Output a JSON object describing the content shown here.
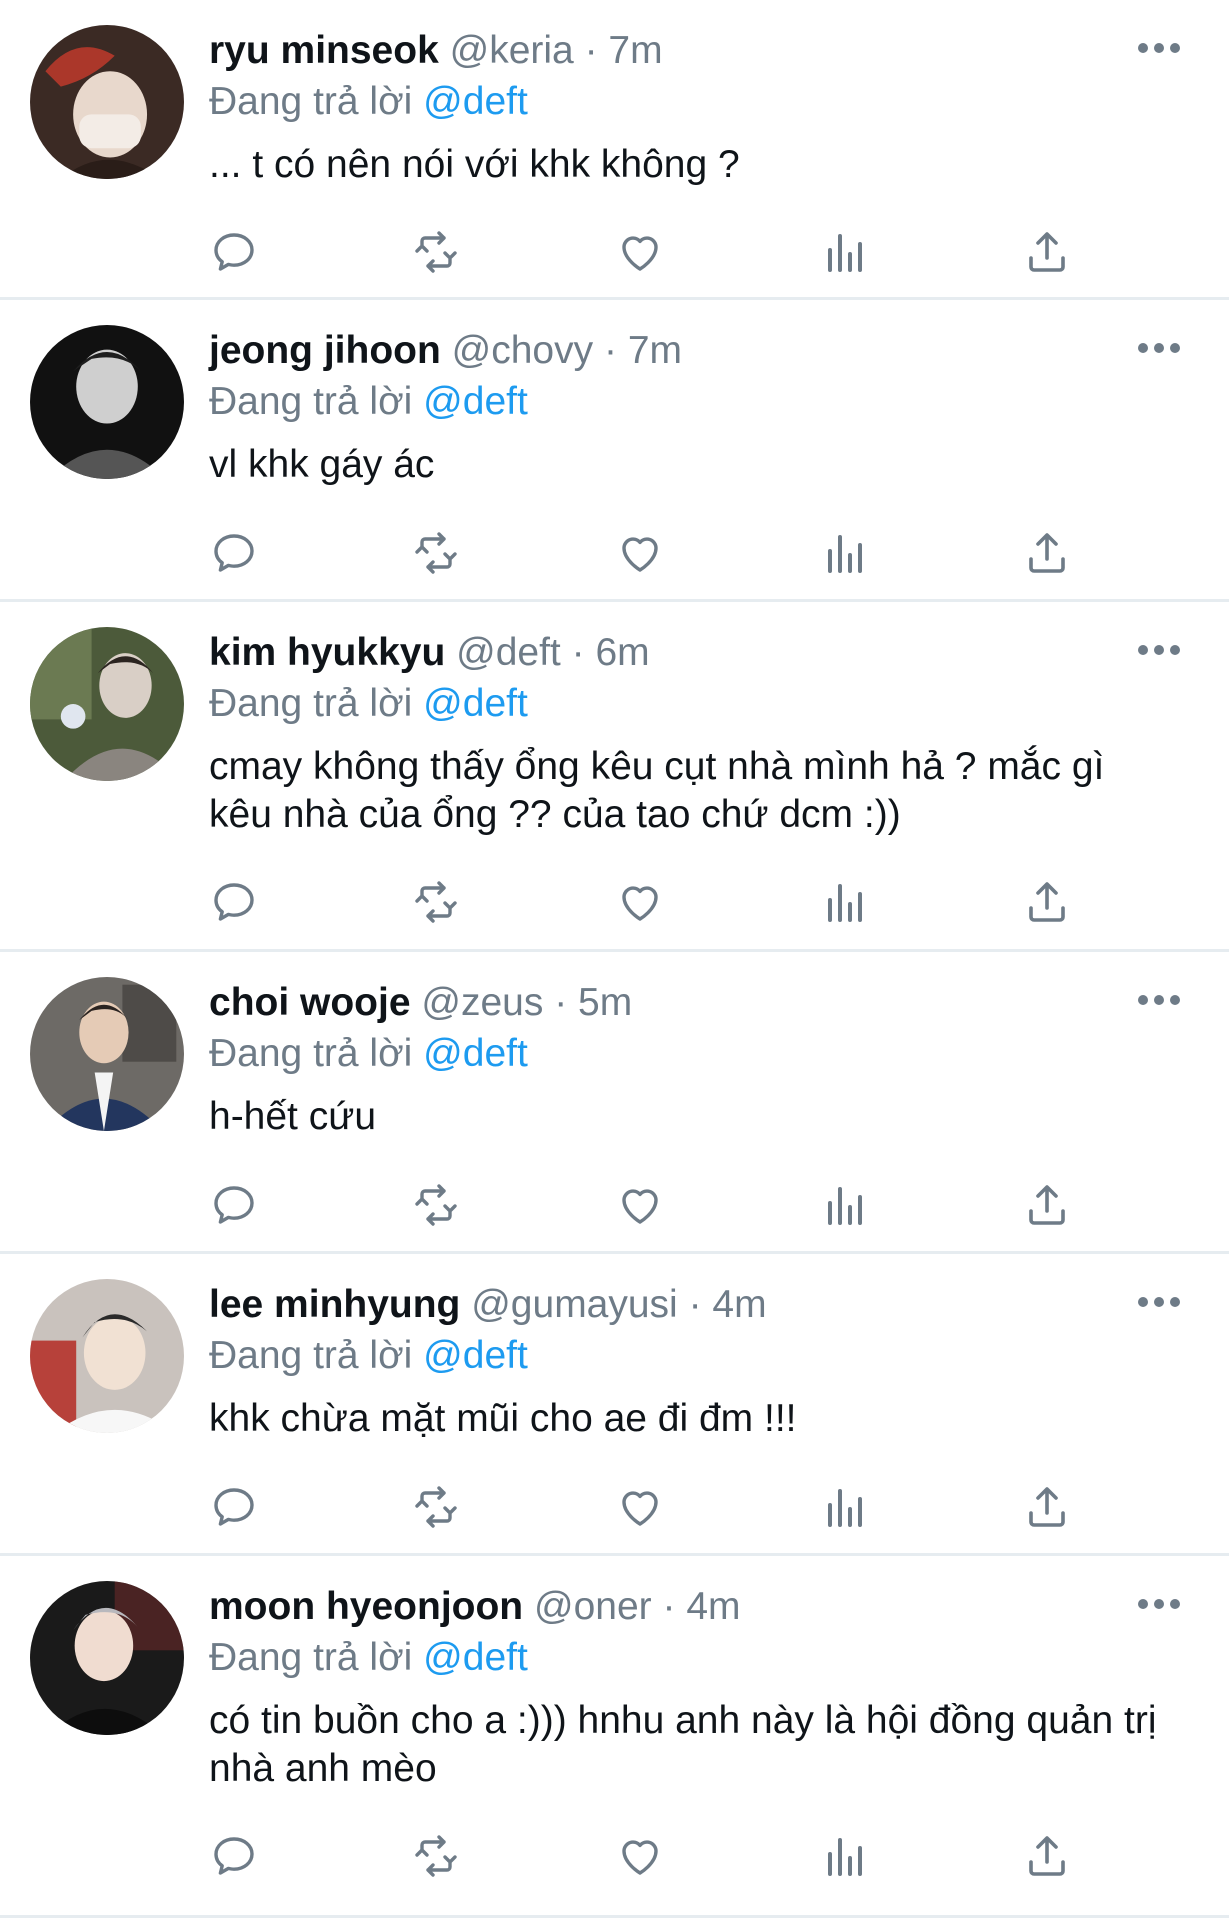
{
  "tweets": [
    {
      "name": "ryu minseok",
      "handle": "@keria",
      "time": "7m",
      "reply_prefix": "Đang trả lời",
      "reply_to": "@deft",
      "text": "... t có nên nói với khk không ?",
      "avatar_colors": [
        "#3b2a24",
        "#c0392b",
        "#e8d8cc"
      ]
    },
    {
      "name": "jeong jihoon",
      "handle": "@chovy",
      "time": "7m",
      "reply_prefix": "Đang trả lời",
      "reply_to": "@deft",
      "text": "vl khk gáy ác",
      "avatar_colors": [
        "#111111",
        "#555555",
        "#cfcfcf"
      ]
    },
    {
      "name": "kim hyukkyu",
      "handle": "@deft",
      "time": "6m",
      "reply_prefix": "Đang trả lời",
      "reply_to": "@deft",
      "text": "cmay không thấy ổng kêu cụt nhà mình hả ? mắc gì kêu nhà của ổng ?? của tao chứ dcm :))",
      "avatar_colors": [
        "#4c5a3a",
        "#d9cfc6",
        "#2b2420"
      ]
    },
    {
      "name": "choi wooje",
      "handle": "@zeus",
      "time": "5m",
      "reply_prefix": "Đang trả lời",
      "reply_to": "@deft",
      "text": "h-hết cứu",
      "avatar_colors": [
        "#6d6a66",
        "#23365e",
        "#e5cbb6"
      ]
    },
    {
      "name": "lee minhyung",
      "handle": "@gumayusi",
      "time": "4m",
      "reply_prefix": "Đang trả lời",
      "reply_to": "@deft",
      "text": "khk chừa mặt mũi cho ae đi đm !!!",
      "avatar_colors": [
        "#c9c2bd",
        "#2a2a2a",
        "#f1e1d3"
      ]
    },
    {
      "name": "moon hyeonjoon",
      "handle": "@oner",
      "time": "4m",
      "reply_prefix": "Đang trả lời",
      "reply_to": "@deft",
      "text": "có tin buồn cho a :))) hnhu anh này là hội đồng quản trị nhà anh mèo",
      "avatar_colors": [
        "#1a1a1a",
        "#b8b8bd",
        "#f0dcd0"
      ]
    }
  ],
  "icons": [
    "reply-icon",
    "retweet-icon",
    "like-icon",
    "analytics-icon",
    "share-icon",
    "more-icon"
  ],
  "colors": {
    "mention": "#1d9bf0",
    "secondary_text": "#6e7b87",
    "primary_text": "#0f1419",
    "divider": "#e6ecf0"
  }
}
